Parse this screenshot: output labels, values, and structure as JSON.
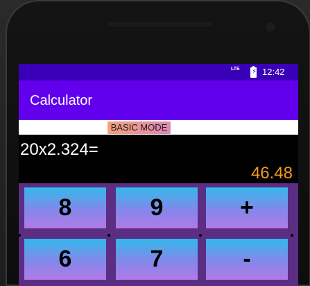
{
  "status_bar": {
    "network": "LTE",
    "time": "12:42"
  },
  "app_bar": {
    "title": "Calculator"
  },
  "mode": {
    "label": "BASIC MODE"
  },
  "display": {
    "expression": "20x2.324=",
    "result": "46.48"
  },
  "keypad": {
    "row1": [
      "8",
      "9",
      "+"
    ],
    "row2": [
      "6",
      "7",
      "-"
    ]
  },
  "colors": {
    "status_bar": "#3a00b8",
    "app_bar": "#6200ee",
    "result_text": "#f49a1c",
    "keypad_bg": "#5b2d83"
  }
}
